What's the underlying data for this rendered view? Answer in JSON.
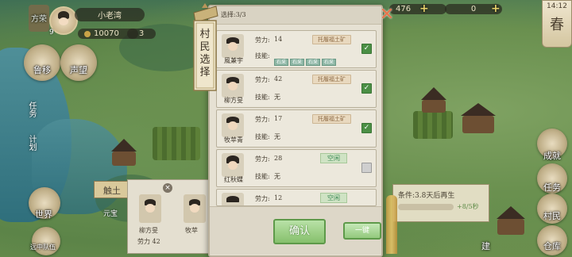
{
  "hud": {
    "player_name": "小老湾",
    "player_level": "9",
    "faction_label": "方荣",
    "coins": "10070",
    "extra_num": "3",
    "res_1": "476",
    "res_2": "0",
    "time": "14:12",
    "season": "春"
  },
  "left_buttons": {
    "mail": "鲁移",
    "fame": "声望",
    "task": "任务",
    "plan": "计划",
    "world": "世界",
    "hutong": "远中队伍"
  },
  "right_buttons": {
    "achieve": "成就",
    "task2": "任务",
    "villager": "村民",
    "warehouse": "仓库",
    "build": "建"
  },
  "under_panel": {
    "title": "触土",
    "sub": "元宝",
    "villager1_name": "柳方旻",
    "villager1_power": "劳力 42",
    "villager2_name": "牧苹"
  },
  "right_info": {
    "text": "条件:3.8天后再生",
    "rate": "+8/5秒"
  },
  "banner": {
    "text": "村民选择"
  },
  "dialog": {
    "selected_label": "选择:3/3",
    "power_label": "劳力:",
    "skill_label": "技能:",
    "none": "无",
    "confirm": "确认",
    "onekey": "一键",
    "rows": [
      {
        "name": "風兼宇",
        "power": "14",
        "status": "托履福土矿",
        "skills": [
          "石采",
          "石采",
          "石采",
          "石采"
        ],
        "checked": true
      },
      {
        "name": "柳方旻",
        "power": "42",
        "status": "托履福土矿",
        "skills": [],
        "checked": true
      },
      {
        "name": "牧苹青",
        "power": "17",
        "status": "托履福土矿",
        "skills": [],
        "checked": true
      },
      {
        "name": "红秋蝶",
        "power": "28",
        "status": "空闲",
        "skills": [],
        "checked": false
      },
      {
        "name": "",
        "power": "12",
        "status": "空闲",
        "skills": [],
        "checked": false
      }
    ]
  },
  "colors": {
    "accent_green": "#4b8f45",
    "tag_brown": "#8d6a45",
    "close_orange": "#e8744a"
  },
  "icons": [
    "close-icon",
    "plus-icon",
    "gear-icon",
    "hourglass-icon",
    "coin-icon",
    "check-icon",
    "wheat-icon"
  ]
}
